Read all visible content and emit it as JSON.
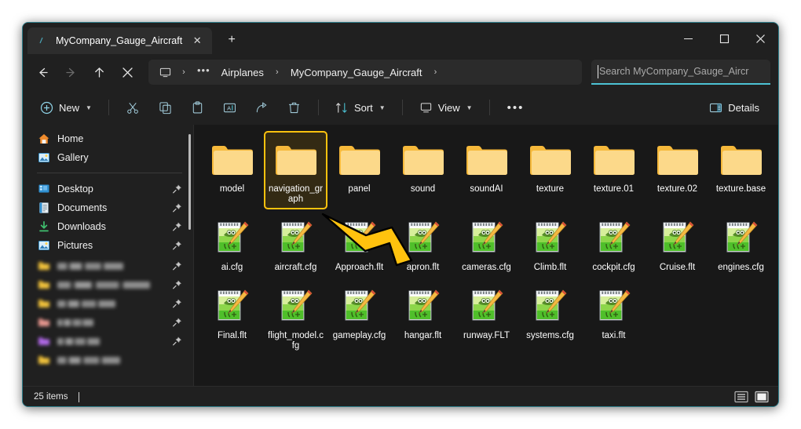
{
  "window": {
    "tab": {
      "title": "MyCompany_Gauge_Aircraft",
      "file_icon": "folder-tab-icon",
      "close_label": "✕"
    },
    "new_tab_label": "+",
    "controls": {
      "minimize": "minimize-icon",
      "maximize": "maximize-icon",
      "close": "close-icon"
    }
  },
  "nav": {
    "back": "back-arrow-icon",
    "forward": "forward-arrow-icon",
    "up": "up-arrow-icon",
    "stop": "stop-icon",
    "breadcrumb": {
      "root_icon": "this-pc-icon",
      "separator": "›",
      "ellipsis": "•••",
      "items": [
        "Airplanes",
        "MyCompany_Gauge_Aircraft"
      ]
    }
  },
  "search": {
    "placeholder": "Search MyCompany_Gauge_Aircr",
    "focused": true,
    "accent": "#4cc2d4"
  },
  "toolbar": {
    "new_label": "New",
    "new_icon": "plus-circle-icon",
    "cut_icon": "scissors-icon",
    "copy_icon": "copy-icon",
    "paste_icon": "paste-icon",
    "rename_icon": "rename-icon",
    "share_icon": "share-icon",
    "delete_icon": "trash-icon",
    "sort_label": "Sort",
    "sort_icon": "sort-icon",
    "view_label": "View",
    "view_icon": "view-icon",
    "more_label": "•••",
    "details_label": "Details",
    "details_icon": "details-pane-icon"
  },
  "sidebar": {
    "quick": [
      {
        "label": "Home",
        "icon": "home-icon",
        "pinned": false,
        "redacted": false
      },
      {
        "label": "Gallery",
        "icon": "gallery-icon",
        "pinned": false,
        "redacted": false
      }
    ],
    "items": [
      {
        "label": "Desktop",
        "icon": "desktop-icon",
        "pinned": true,
        "redacted": false
      },
      {
        "label": "Documents",
        "icon": "documents-icon",
        "pinned": true,
        "redacted": false
      },
      {
        "label": "Downloads",
        "icon": "downloads-icon",
        "pinned": true,
        "redacted": false
      },
      {
        "label": "Pictures",
        "icon": "pictures-icon",
        "pinned": true,
        "redacted": false
      },
      {
        "label": "",
        "icon": "folder-icon",
        "pinned": true,
        "redacted": true
      },
      {
        "label": "",
        "icon": "folder-icon",
        "pinned": true,
        "redacted": true
      },
      {
        "label": "",
        "icon": "folder-icon",
        "pinned": true,
        "redacted": true
      },
      {
        "label": "",
        "icon": "folder-icon",
        "pinned": true,
        "redacted": true
      },
      {
        "label": "",
        "icon": "folder-icon",
        "pinned": true,
        "redacted": true
      },
      {
        "label": "",
        "icon": "folder-icon",
        "pinned": false,
        "redacted": true
      }
    ]
  },
  "files": {
    "selected_name": "navigation_graph",
    "selection_color": "#ffc20e",
    "entries": [
      {
        "name": "model",
        "type": "folder"
      },
      {
        "name": "navigation_graph",
        "type": "folder",
        "selected": true
      },
      {
        "name": "panel",
        "type": "folder"
      },
      {
        "name": "sound",
        "type": "folder"
      },
      {
        "name": "soundAI",
        "type": "folder"
      },
      {
        "name": "texture",
        "type": "folder"
      },
      {
        "name": "texture.01",
        "type": "folder"
      },
      {
        "name": "texture.02",
        "type": "folder"
      },
      {
        "name": "texture.base",
        "type": "folder"
      },
      {
        "name": "ai.cfg",
        "type": "file"
      },
      {
        "name": "aircraft.cfg",
        "type": "file"
      },
      {
        "name": "Approach.flt",
        "type": "file"
      },
      {
        "name": "apron.flt",
        "type": "file"
      },
      {
        "name": "cameras.cfg",
        "type": "file"
      },
      {
        "name": "Climb.flt",
        "type": "file"
      },
      {
        "name": "cockpit.cfg",
        "type": "file"
      },
      {
        "name": "Cruise.flt",
        "type": "file"
      },
      {
        "name": "engines.cfg",
        "type": "file"
      },
      {
        "name": "Final.flt",
        "type": "file"
      },
      {
        "name": "flight_model.cfg",
        "type": "file"
      },
      {
        "name": "gameplay.cfg",
        "type": "file"
      },
      {
        "name": "hangar.flt",
        "type": "file"
      },
      {
        "name": "runway.FLT",
        "type": "file"
      },
      {
        "name": "systems.cfg",
        "type": "file"
      },
      {
        "name": "taxi.flt",
        "type": "file"
      }
    ]
  },
  "status": {
    "item_count": "25 items",
    "list_view_icon": "list-view-icon",
    "icon_view_icon": "large-icons-view-icon"
  },
  "annotation": {
    "arrow_icon": "pointer-arrow-annotation",
    "color": "#ffc20e"
  }
}
